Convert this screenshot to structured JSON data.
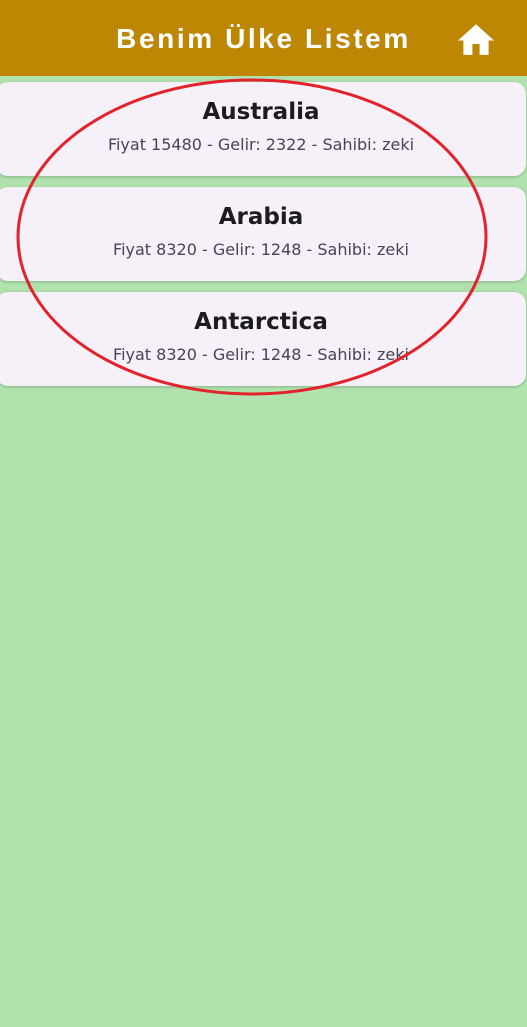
{
  "app_bar": {
    "title": "Benim Ülke Listem",
    "home_icon": "home-icon",
    "background": "#bd8704"
  },
  "countries": [
    {
      "name": "Australia",
      "details": "Fiyat 15480 - Gelir: 2322 - Sahibi: zeki"
    },
    {
      "name": "Arabia",
      "details": "Fiyat 8320 - Gelir: 1248 - Sahibi: zeki"
    },
    {
      "name": "Antarctica",
      "details": "Fiyat 8320 - Gelir: 1248 - Sahibi: zeki"
    }
  ],
  "colors": {
    "page_background": "#b0e2ae",
    "card_background": "#f6f1f8",
    "annotation": "#e3222b"
  }
}
